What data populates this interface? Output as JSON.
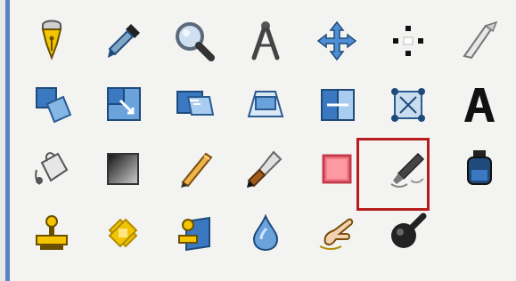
{
  "panel": {
    "title": "",
    "accent": "#5b83c6",
    "selection_color": "#b61c1c"
  },
  "tools": [
    {
      "name": "paths-tool",
      "icon": "pen-nib-icon"
    },
    {
      "name": "color-picker-tool",
      "icon": "eyedropper-icon"
    },
    {
      "name": "zoom-tool",
      "icon": "magnifier-icon"
    },
    {
      "name": "measure-tool",
      "icon": "compass-icon"
    },
    {
      "name": "move-tool",
      "icon": "move-arrows-icon"
    },
    {
      "name": "alignment-tool",
      "icon": "align-icon"
    },
    {
      "name": "crop-tool",
      "icon": "knife-icon"
    },
    {
      "name": "rotate-tool",
      "icon": "rotate-icon"
    },
    {
      "name": "scale-tool",
      "icon": "scale-icon"
    },
    {
      "name": "shear-tool",
      "icon": "shear-icon"
    },
    {
      "name": "perspective-tool",
      "icon": "perspective-icon"
    },
    {
      "name": "flip-tool",
      "icon": "flip-icon"
    },
    {
      "name": "cage-transform-tool",
      "icon": "cage-icon"
    },
    {
      "name": "text-tool",
      "icon": "text-a-icon"
    },
    {
      "name": "bucket-fill-tool",
      "icon": "bucket-icon"
    },
    {
      "name": "blend-tool",
      "icon": "gradient-icon"
    },
    {
      "name": "pencil-tool",
      "icon": "pencil-icon"
    },
    {
      "name": "paintbrush-tool",
      "icon": "brush-icon"
    },
    {
      "name": "eraser-tool",
      "icon": "eraser-icon"
    },
    {
      "name": "airbrush-tool",
      "icon": "airbrush-icon"
    },
    {
      "name": "ink-tool",
      "icon": "ink-bottle-icon"
    },
    {
      "name": "clone-tool",
      "icon": "stamp-icon"
    },
    {
      "name": "healing-tool",
      "icon": "bandage-icon"
    },
    {
      "name": "perspective-clone-tool",
      "icon": "perspective-stamp-icon"
    },
    {
      "name": "blur-sharpen-tool",
      "icon": "drop-icon"
    },
    {
      "name": "smudge-tool",
      "icon": "finger-icon"
    },
    {
      "name": "dodge-burn-tool",
      "icon": "dodge-icon"
    }
  ],
  "selected_tool": "airbrush-tool"
}
